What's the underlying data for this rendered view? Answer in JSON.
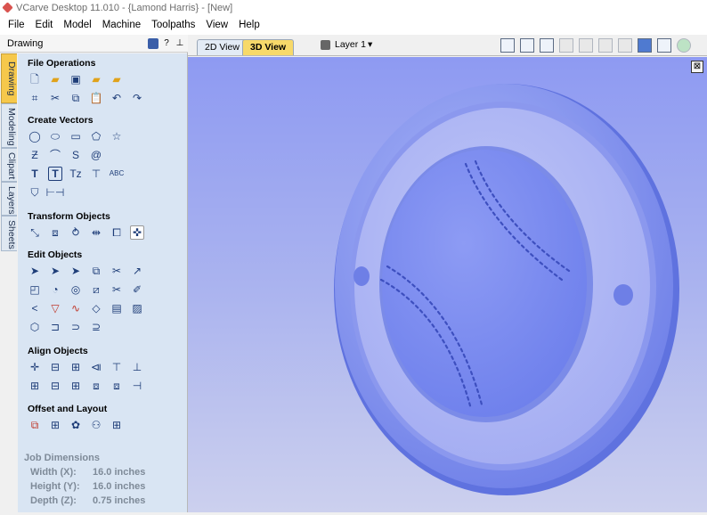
{
  "window": {
    "title": "VCarve Desktop 11.010 - {Lamond Harris} - [New]"
  },
  "menu": [
    "File",
    "Edit",
    "Model",
    "Machine",
    "Toolpaths",
    "View",
    "Help"
  ],
  "panel": {
    "title": "Drawing",
    "tabs": [
      "Drawing",
      "Modeling",
      "Clipart",
      "Layers",
      "Sheets"
    ],
    "sections": {
      "file_operations": "File Operations",
      "create_vectors": "Create Vectors",
      "transform_objects": "Transform Objects",
      "edit_objects": "Edit Objects",
      "align_objects": "Align Objects",
      "offset_layout": "Offset and Layout"
    },
    "job": {
      "heading": "Job Dimensions",
      "width_label": "Width  (X):",
      "width_value": "16.0 inches",
      "height_label": "Height (Y):",
      "height_value": "16.0 inches",
      "depth_label": "Depth  (Z):",
      "depth_value": "0.75 inches"
    }
  },
  "view_tabs": [
    "2D View",
    "3D View"
  ],
  "active_view": "3D View",
  "layer": {
    "label": "Layer 1"
  },
  "colors": {
    "accent": "#f6c84b",
    "viewport": "#a3acef",
    "model": "#7f8ff0"
  }
}
